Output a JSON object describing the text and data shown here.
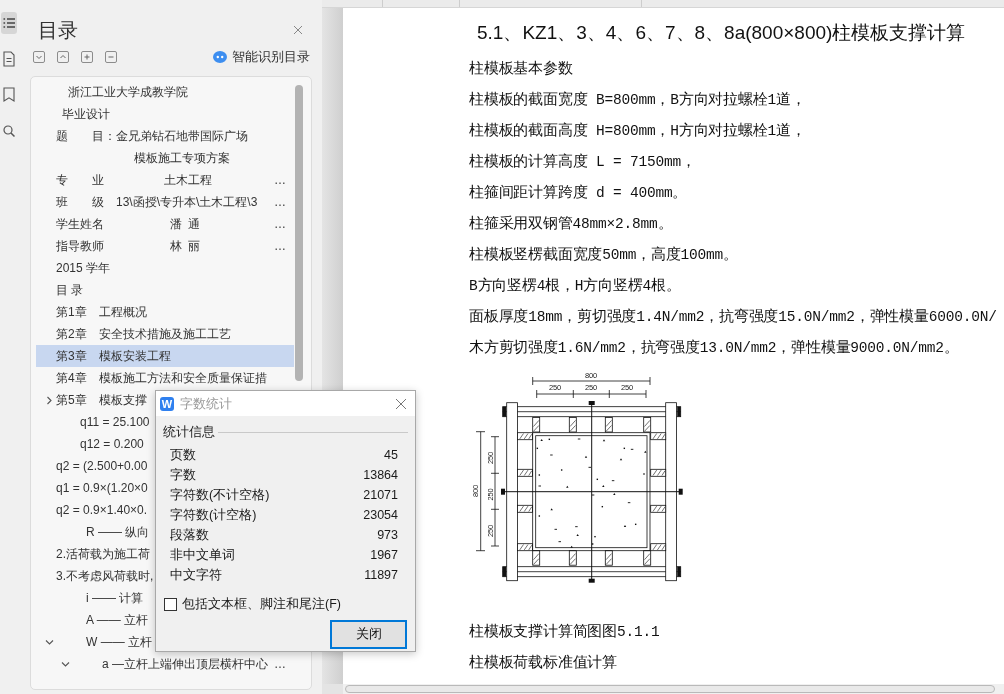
{
  "rail": {
    "items": [
      {
        "selected": true
      },
      {
        "selected": false
      },
      {
        "selected": false
      },
      {
        "selected": false
      }
    ]
  },
  "toc_panel": {
    "title": "目录",
    "smart_toc_button": "智能识别目录",
    "items": [
      {
        "text": "　浙江工业大学成教学院",
        "selected": false
      },
      {
        "text": " 毕业设计",
        "selected": false
      },
      {
        "text": "题　　目：金兄弟钻石地带国际广场",
        "selected": false
      },
      {
        "text": "　　　　　　 模板施工专项方案",
        "selected": false
      },
      {
        "text": "专　　业　　　　　土木工程",
        "ellipsis": "…",
        "selected": false
      },
      {
        "text": "班　　级　13\\函授\\专升本\\土木工程\\3",
        "ellipsis": "…",
        "selected": false
      },
      {
        "text": "学生姓名　　　　　 潘 通",
        "ellipsis": "…",
        "selected": false
      },
      {
        "text": "指导教师　　　　　 林 丽",
        "ellipsis": "…",
        "selected": false
      },
      {
        "text": "2015 学年",
        "selected": false
      },
      {
        "text": "目 录",
        "selected": false
      },
      {
        "text": "第1章　工程概况",
        "selected": false
      },
      {
        "text": "第2章　安全技术措施及施工工艺",
        "selected": false
      },
      {
        "text": "第3章　模板安装工程",
        "selected": true
      },
      {
        "text": "第4章　模板施工方法和安全质量保证措",
        "selected": false
      },
      {
        "text": "第5章　模板支撑",
        "expanded": false,
        "selected": false
      },
      {
        "text": "　　q11 = 25.100",
        "selected": false
      },
      {
        "text": "　　q12 = 0.200",
        "selected": false
      },
      {
        "text": "q2 = (2.500+0.00",
        "selected": false
      },
      {
        "text": "q1 = 0.9×(1.20×0",
        "selected": false
      },
      {
        "text": "q2 = 0.9×1.40×0.",
        "selected": false
      },
      {
        "text": "　　 R —— 纵向",
        "selected": false
      },
      {
        "text": "2.活荷载为施工荷",
        "selected": false
      },
      {
        "text": "3.不考虑风荷载时,",
        "selected": false
      },
      {
        "text": "　　 i —— 计算",
        "selected": false
      },
      {
        "text": "　　 A —— 立杆",
        "selected": false
      },
      {
        "text": "　　 W —— 立杆",
        "expanded": true,
        "selected": false,
        "children": [
          {
            "text": "　　 a —立杆上端伸出顶层横杆中心",
            "ellipsis": "…",
            "expanded": true,
            "selected": false
          }
        ]
      }
    ]
  },
  "document": {
    "blocks": [
      {
        "kind": "heading",
        "text": "5.1、KZ1、3、4、6、7、8、8a(800×800)柱模板支撑计算"
      },
      {
        "kind": "text",
        "text": "柱模板基本参数"
      },
      {
        "kind": "text",
        "text": "柱模板的截面宽度 B=800mm，B方向对拉螺栓1道，"
      },
      {
        "kind": "text",
        "text": "柱模板的截面高度 H=800mm，H方向对拉螺栓1道，"
      },
      {
        "kind": "text",
        "text": "柱模板的计算高度 L = 7150mm，"
      },
      {
        "kind": "text",
        "text": "柱箍间距计算跨度 d = 400mm。"
      },
      {
        "kind": "text",
        "text": "柱箍采用双钢管48mm×2.8mm。"
      },
      {
        "kind": "text",
        "text": "柱模板竖楞截面宽度50mm，高度100mm。"
      },
      {
        "kind": "text",
        "text": "B方向竖楞4根，H方向竖楞4根。"
      },
      {
        "kind": "text",
        "text": "面板厚度18mm，剪切强度1.4N/mm2，抗弯强度15.0N/mm2，弹性模量6000.0N/"
      },
      {
        "kind": "text",
        "text": "木方剪切强度1.6N/mm2，抗弯强度13.0N/mm2，弹性模量9000.0N/mm2。"
      },
      {
        "kind": "figure",
        "horizontal": {
          "total": "800",
          "parts": [
            "250",
            "250",
            "250"
          ]
        },
        "vertical": {
          "total": "800",
          "parts": [
            "250",
            "250",
            "250"
          ]
        }
      },
      {
        "kind": "caption",
        "text": "柱模板支撑计算简图图5.1.1"
      },
      {
        "kind": "text",
        "text": "柱模板荷载标准值计算"
      }
    ]
  },
  "dialog": {
    "app_logo": "W",
    "title": "字数统计",
    "group_label": "统计信息",
    "stats": [
      {
        "label": "页数",
        "value": "45"
      },
      {
        "label": "字数",
        "value": "13864"
      },
      {
        "label": "字符数(不计空格)",
        "value": "21071"
      },
      {
        "label": "字符数(计空格)",
        "value": "23054"
      },
      {
        "label": "段落数",
        "value": "973"
      },
      {
        "label": "非中文单词",
        "value": "1967"
      },
      {
        "label": "中文字符",
        "value": "11897"
      }
    ],
    "include_option": {
      "label": "包括文本框、脚注和尾注(F)",
      "checked": false
    },
    "close_button": "关闭"
  }
}
